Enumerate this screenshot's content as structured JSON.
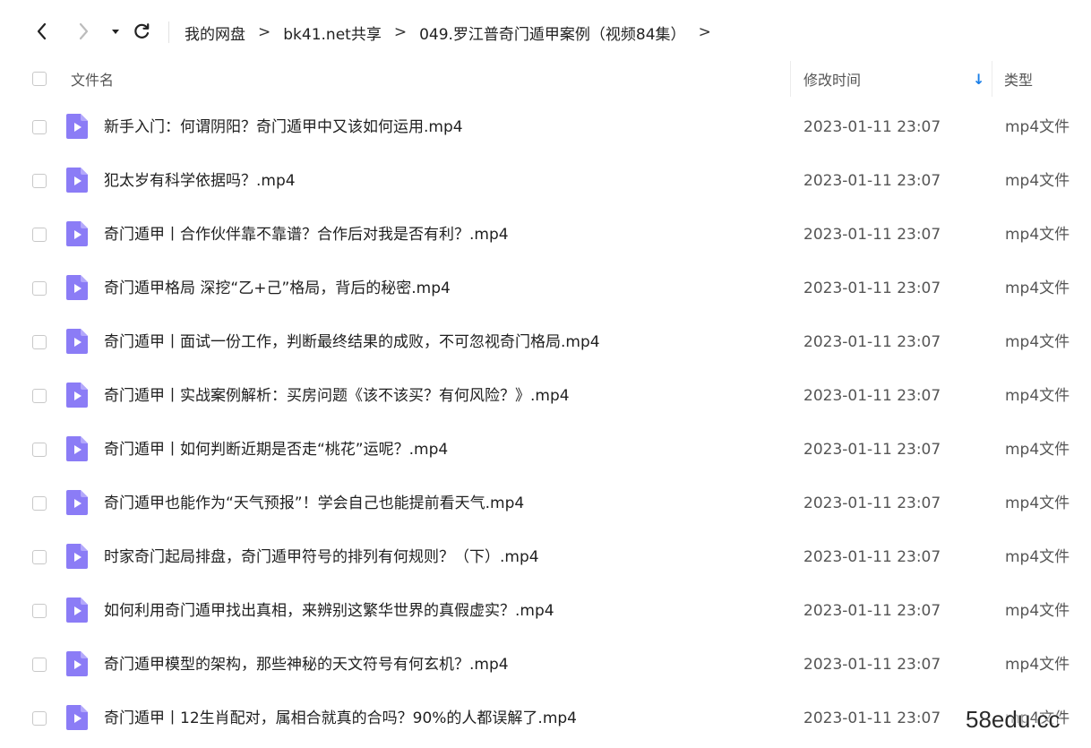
{
  "toolbar": {
    "breadcrumbs": [
      "我的网盘",
      "bk41.net共享",
      "049.罗江普奇门遁甲案例（视频84集）"
    ],
    "separator": ">"
  },
  "table": {
    "headers": {
      "name": "文件名",
      "modified": "修改时间",
      "type": "类型"
    },
    "sort_indicator": "↓",
    "rows": [
      {
        "name": "新手入门：何谓阴阳？奇门遁甲中又该如何运用.mp4",
        "modified": "2023-01-11 23:07",
        "type": "mp4文件"
      },
      {
        "name": "犯太岁有科学依据吗？.mp4",
        "modified": "2023-01-11 23:07",
        "type": "mp4文件"
      },
      {
        "name": "奇门遁甲丨合作伙伴靠不靠谱？合作后对我是否有利？.mp4",
        "modified": "2023-01-11 23:07",
        "type": "mp4文件"
      },
      {
        "name": "奇门遁甲格局 深挖“乙+己”格局，背后的秘密.mp4",
        "modified": "2023-01-11 23:07",
        "type": "mp4文件"
      },
      {
        "name": "奇门遁甲丨面试一份工作，判断最终结果的成败，不可忽视奇门格局.mp4",
        "modified": "2023-01-11 23:07",
        "type": "mp4文件"
      },
      {
        "name": "奇门遁甲丨实战案例解析：买房问题《该不该买？有何风险？》.mp4",
        "modified": "2023-01-11 23:07",
        "type": "mp4文件"
      },
      {
        "name": "奇门遁甲丨如何判断近期是否走“桃花”运呢？.mp4",
        "modified": "2023-01-11 23:07",
        "type": "mp4文件"
      },
      {
        "name": "奇门遁甲也能作为“天气预报”！学会自己也能提前看天气.mp4",
        "modified": "2023-01-11 23:07",
        "type": "mp4文件"
      },
      {
        "name": "时家奇门起局排盘，奇门遁甲符号的排列有何规则？（下）.mp4",
        "modified": "2023-01-11 23:07",
        "type": "mp4文件"
      },
      {
        "name": "如何利用奇门遁甲找出真相，来辨别这繁华世界的真假虚实？.mp4",
        "modified": "2023-01-11 23:07",
        "type": "mp4文件"
      },
      {
        "name": "奇门遁甲模型的架构，那些神秘的天文符号有何玄机？.mp4",
        "modified": "2023-01-11 23:07",
        "type": "mp4文件"
      },
      {
        "name": "奇门遁甲丨12生肖配对，属相合就真的合吗？90%的人都误解了.mp4",
        "modified": "2023-01-11 23:07",
        "type": "mp4文件"
      }
    ]
  },
  "icons": {
    "back": "chevron-left-icon",
    "forward": "chevron-right-icon",
    "history": "caret-down-icon",
    "refresh": "refresh-icon",
    "file": "video-file-icon",
    "sort": "sort-desc-icon"
  },
  "colors": {
    "file_icon": "#8b7cf6",
    "sort_arrow": "#1a7fe8"
  },
  "watermark": "58edu.cc"
}
